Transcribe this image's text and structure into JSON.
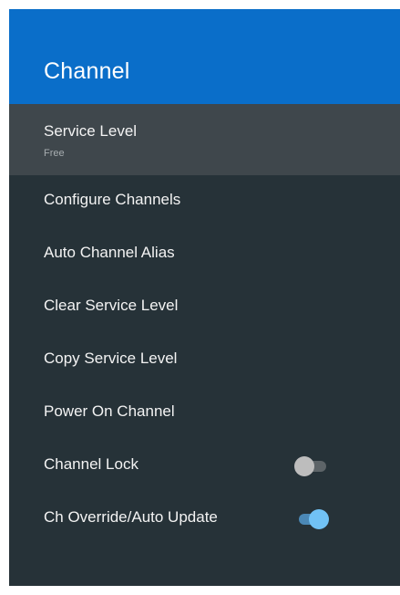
{
  "header": {
    "title": "Channel"
  },
  "menu": {
    "items": [
      {
        "label": "Service Level",
        "sublabel": "Free"
      },
      {
        "label": "Configure Channels"
      },
      {
        "label": "Auto Channel Alias"
      },
      {
        "label": "Clear Service Level"
      },
      {
        "label": "Copy Service Level"
      },
      {
        "label": "Power On Channel"
      },
      {
        "label": "Channel Lock",
        "toggle": "off"
      },
      {
        "label": "Ch Override/Auto Update",
        "toggle": "on"
      }
    ]
  },
  "colors": {
    "header_bg": "#0a6ec9",
    "panel_bg": "#263238",
    "selected_row_bg": "#3f474c",
    "toggle_on": "#71c2f5",
    "toggle_off": "#bdbdbd"
  }
}
